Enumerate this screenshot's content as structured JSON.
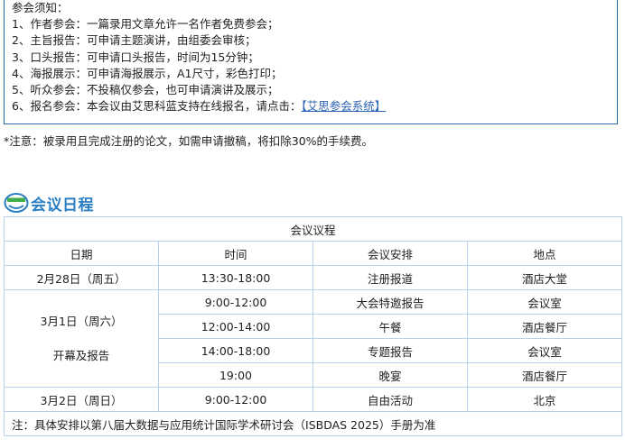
{
  "notice": {
    "title": "参会须知：",
    "items": [
      "1、作者参会：一篇录用文章允许一名作者免费参会；",
      "2、主旨报告：可申请主题演讲，由组委会审核；",
      "3、口头报告：可申请口头报告，时间为15分钟；",
      "4、海报展示：可申请海报展示，A1尺寸，彩色打印；",
      "5、听众参会：不投稿仅参会，也可申请演讲及展示；"
    ],
    "item6_prefix": "6、报名参会：本会议由艾思科蓝支持在线报名，请点击：",
    "item6_link": "【艾思参会系统】"
  },
  "note": "*注意：被录用且完成注册的论文，如需申请撤稿，将扣除30%的手续费。",
  "section_title": "会议日程",
  "schedule": {
    "caption": "会议议程",
    "headers": [
      "日期",
      "时间",
      "会议安排",
      "地点"
    ],
    "day1": {
      "date": "2月28日（周五）",
      "time": "13:30-18:00",
      "event": "注册报道",
      "place": "酒店大堂"
    },
    "day2_date": "3月1日（周六）",
    "day2_subtitle": "开幕及报告",
    "day2_rows": [
      {
        "time": "9:00-12:00",
        "event": "大会特邀报告",
        "place": "会议室"
      },
      {
        "time": "12:00-14:00",
        "event": "午餐",
        "place": "酒店餐厅"
      },
      {
        "time": "14:00-18:00",
        "event": "专题报告",
        "place": "会议室"
      },
      {
        "time": "19:00",
        "event": "晚宴",
        "place": "酒店餐厅"
      }
    ],
    "day3": {
      "date": "3月2日（周日）",
      "time": "9:00-12:00",
      "event": "自由活动",
      "place": "北京"
    },
    "footnote": "注：具体安排以第八届大数据与应用统计国际学术研讨会（ISBDAS 2025）手册为准"
  },
  "colors": {
    "accent": "#2a7ec4",
    "border": "#b7d2ec",
    "link": "#2a62b5"
  }
}
